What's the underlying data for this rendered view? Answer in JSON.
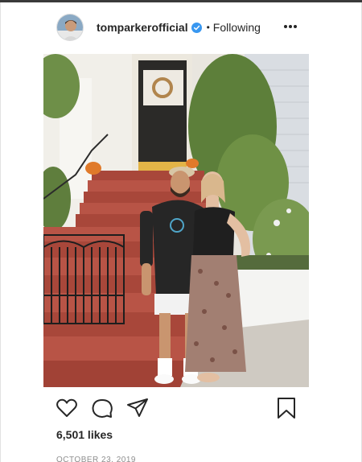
{
  "header": {
    "username": "tomparkerofficial",
    "dot": "•",
    "follow_label": "Following",
    "more_icon": "more-horizontal-icon",
    "verified_icon": "verified-badge-icon"
  },
  "post": {
    "photo_alt": "Man in black t-shirt, white shorts and cap standing with a woman in a black top and floral skirt in front of red brick steps and iron gate of a house"
  },
  "actions": {
    "like_icon": "heart-icon",
    "comment_icon": "comment-icon",
    "share_icon": "share-icon",
    "save_icon": "bookmark-icon"
  },
  "likes_text": "6,501 likes",
  "date_text": "OCTOBER 23, 2019",
  "colors": {
    "verified_blue": "#3897f0",
    "text": "#262626",
    "muted": "#8e8e8e"
  }
}
